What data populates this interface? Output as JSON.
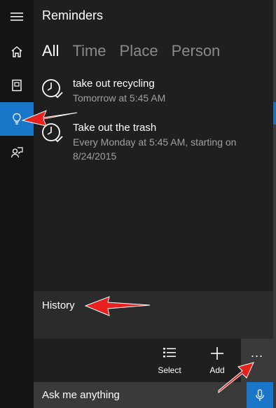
{
  "app": {
    "title": "Reminders"
  },
  "tabs": [
    {
      "label": "All"
    },
    {
      "label": "Time"
    },
    {
      "label": "Place"
    },
    {
      "label": "Person"
    }
  ],
  "reminders": [
    {
      "name": "take out recycling",
      "when": "Tomorrow at 5:45 AM"
    },
    {
      "name": "Take out the trash",
      "when": "Every Monday at 5:45 AM, starting on 8/24/2015"
    }
  ],
  "history": {
    "label": "History"
  },
  "commandbar": {
    "select_label": "Select",
    "add_label": "Add",
    "more_label": "..."
  },
  "search": {
    "placeholder": "Ask me anything"
  },
  "colors": {
    "accent": "#1976c8",
    "annotation": "#e8201e"
  }
}
